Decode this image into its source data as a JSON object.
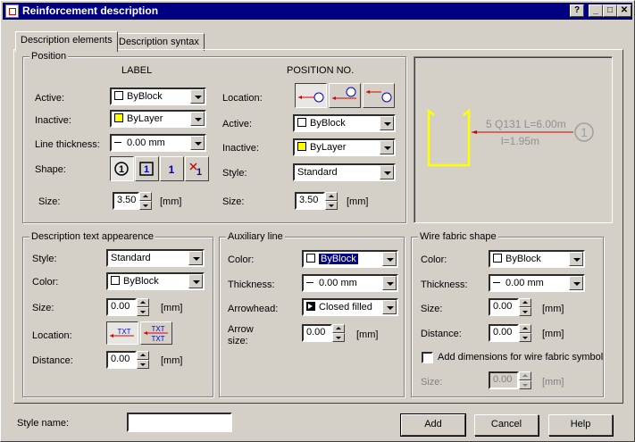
{
  "window": {
    "title": "Reinforcement description",
    "buttons": {
      "help": "?",
      "minimize": "_",
      "maximize": "□",
      "close": "✕"
    }
  },
  "tabs": [
    {
      "label": "Description elements"
    },
    {
      "label": "Description syntax"
    }
  ],
  "position": {
    "title": "Position",
    "label_header": "LABEL",
    "posno_header": "POSITION NO.",
    "label": {
      "active_label": "Active:",
      "active_value": "ByBlock",
      "active_color": "#ffffff",
      "inactive_label": "Inactive:",
      "inactive_value": "ByLayer",
      "inactive_color": "#ffff00",
      "thickness_label": "Line thickness:",
      "thickness_value": "0.00 mm",
      "shape_label": "Shape:",
      "shapes": [
        "1",
        "1",
        "1",
        "1"
      ],
      "size_label": "Size:",
      "size_value": "3.50",
      "size_unit": "[mm]"
    },
    "posno": {
      "location_label": "Location:",
      "active_label": "Active:",
      "active_value": "ByBlock",
      "active_color": "#ffffff",
      "inactive_label": "Inactive:",
      "inactive_value": "ByLayer",
      "inactive_color": "#ffff00",
      "style_label": "Style:",
      "style_value": "Standard",
      "size_label": "Size:",
      "size_value": "3.50",
      "size_unit": "[mm]"
    }
  },
  "preview": {
    "line1": "5 Q131 L=6.00m",
    "line2": "l=1.95m",
    "number": "1"
  },
  "desc_text": {
    "title": "Description text appearence",
    "style_label": "Style:",
    "style_value": "Standard",
    "color_label": "Color:",
    "color_value": "ByBlock",
    "color_swatch": "#ffffff",
    "size_label": "Size:",
    "size_value": "0.00",
    "size_unit": "[mm]",
    "location_label": "Location:",
    "loc_btn1": "TXT",
    "loc_btn2_a": "TXT",
    "loc_btn2_b": "TXT",
    "distance_label": "Distance:",
    "distance_value": "0.00",
    "distance_unit": "[mm]"
  },
  "aux_line": {
    "title": "Auxiliary line",
    "color_label": "Color:",
    "color_value": "ByBlock",
    "color_swatch": "#ffffff",
    "thickness_label": "Thickness:",
    "thickness_value": "0.00 mm",
    "arrowhead_label": "Arrowhead:",
    "arrowhead_value": "Closed filled",
    "arrowsize_label1": "Arrow",
    "arrowsize_label2": "size:",
    "arrowsize_value": "0.00",
    "arrowsize_unit": "[mm]"
  },
  "wire_fabric": {
    "title": "Wire fabric shape",
    "color_label": "Color:",
    "color_value": "ByBlock",
    "color_swatch": "#ffffff",
    "thickness_label": "Thickness:",
    "thickness_value": "0.00 mm",
    "size_label": "Size:",
    "size_value": "0.00",
    "size_unit": "[mm]",
    "distance_label": "Distance:",
    "distance_value": "0.00",
    "distance_unit": "[mm]",
    "dims_checkbox_label": "Add dimensions for wire fabric symbol",
    "dims_size_label": "Size:",
    "dims_size_value": "0.00",
    "dims_size_unit": "[mm]"
  },
  "footer": {
    "style_name_label": "Style name:",
    "style_name_value": "",
    "add": "Add",
    "cancel": "Cancel",
    "help": "Help"
  }
}
